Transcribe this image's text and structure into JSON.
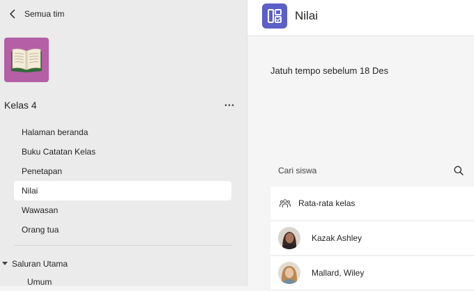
{
  "sidebar": {
    "back_label": "Semua tim",
    "team_name": "Kelas 4",
    "items": [
      {
        "label": "Halaman beranda"
      },
      {
        "label": "Buku Catatan Kelas"
      },
      {
        "label": "Penetapan"
      },
      {
        "label": "Nilai",
        "active": true
      },
      {
        "label": "Wawasan"
      },
      {
        "label": "Orang tua"
      }
    ],
    "channel_group": "Saluran Utama",
    "channel": "Umum"
  },
  "header": {
    "title": "Nilai"
  },
  "main": {
    "due_text": "Jatuh tempo sebelum 18 Des",
    "search_placeholder": "Cari siswa",
    "average_label": "Rata-rata kelas",
    "students": [
      {
        "name": "Kazak Ashley"
      },
      {
        "name": "Mallard, Wiley"
      }
    ]
  },
  "colors": {
    "team_avatar_bg": "#b55fa6",
    "app_icon_bg": "#5b5fc7",
    "sidebar_bg": "#ebebeb",
    "active_item_bg": "#ffffff"
  },
  "icons": [
    "chevron-left-icon",
    "book-icon",
    "more-icon",
    "grades-app-icon",
    "search-icon",
    "people-icon",
    "caret-down-icon"
  ]
}
